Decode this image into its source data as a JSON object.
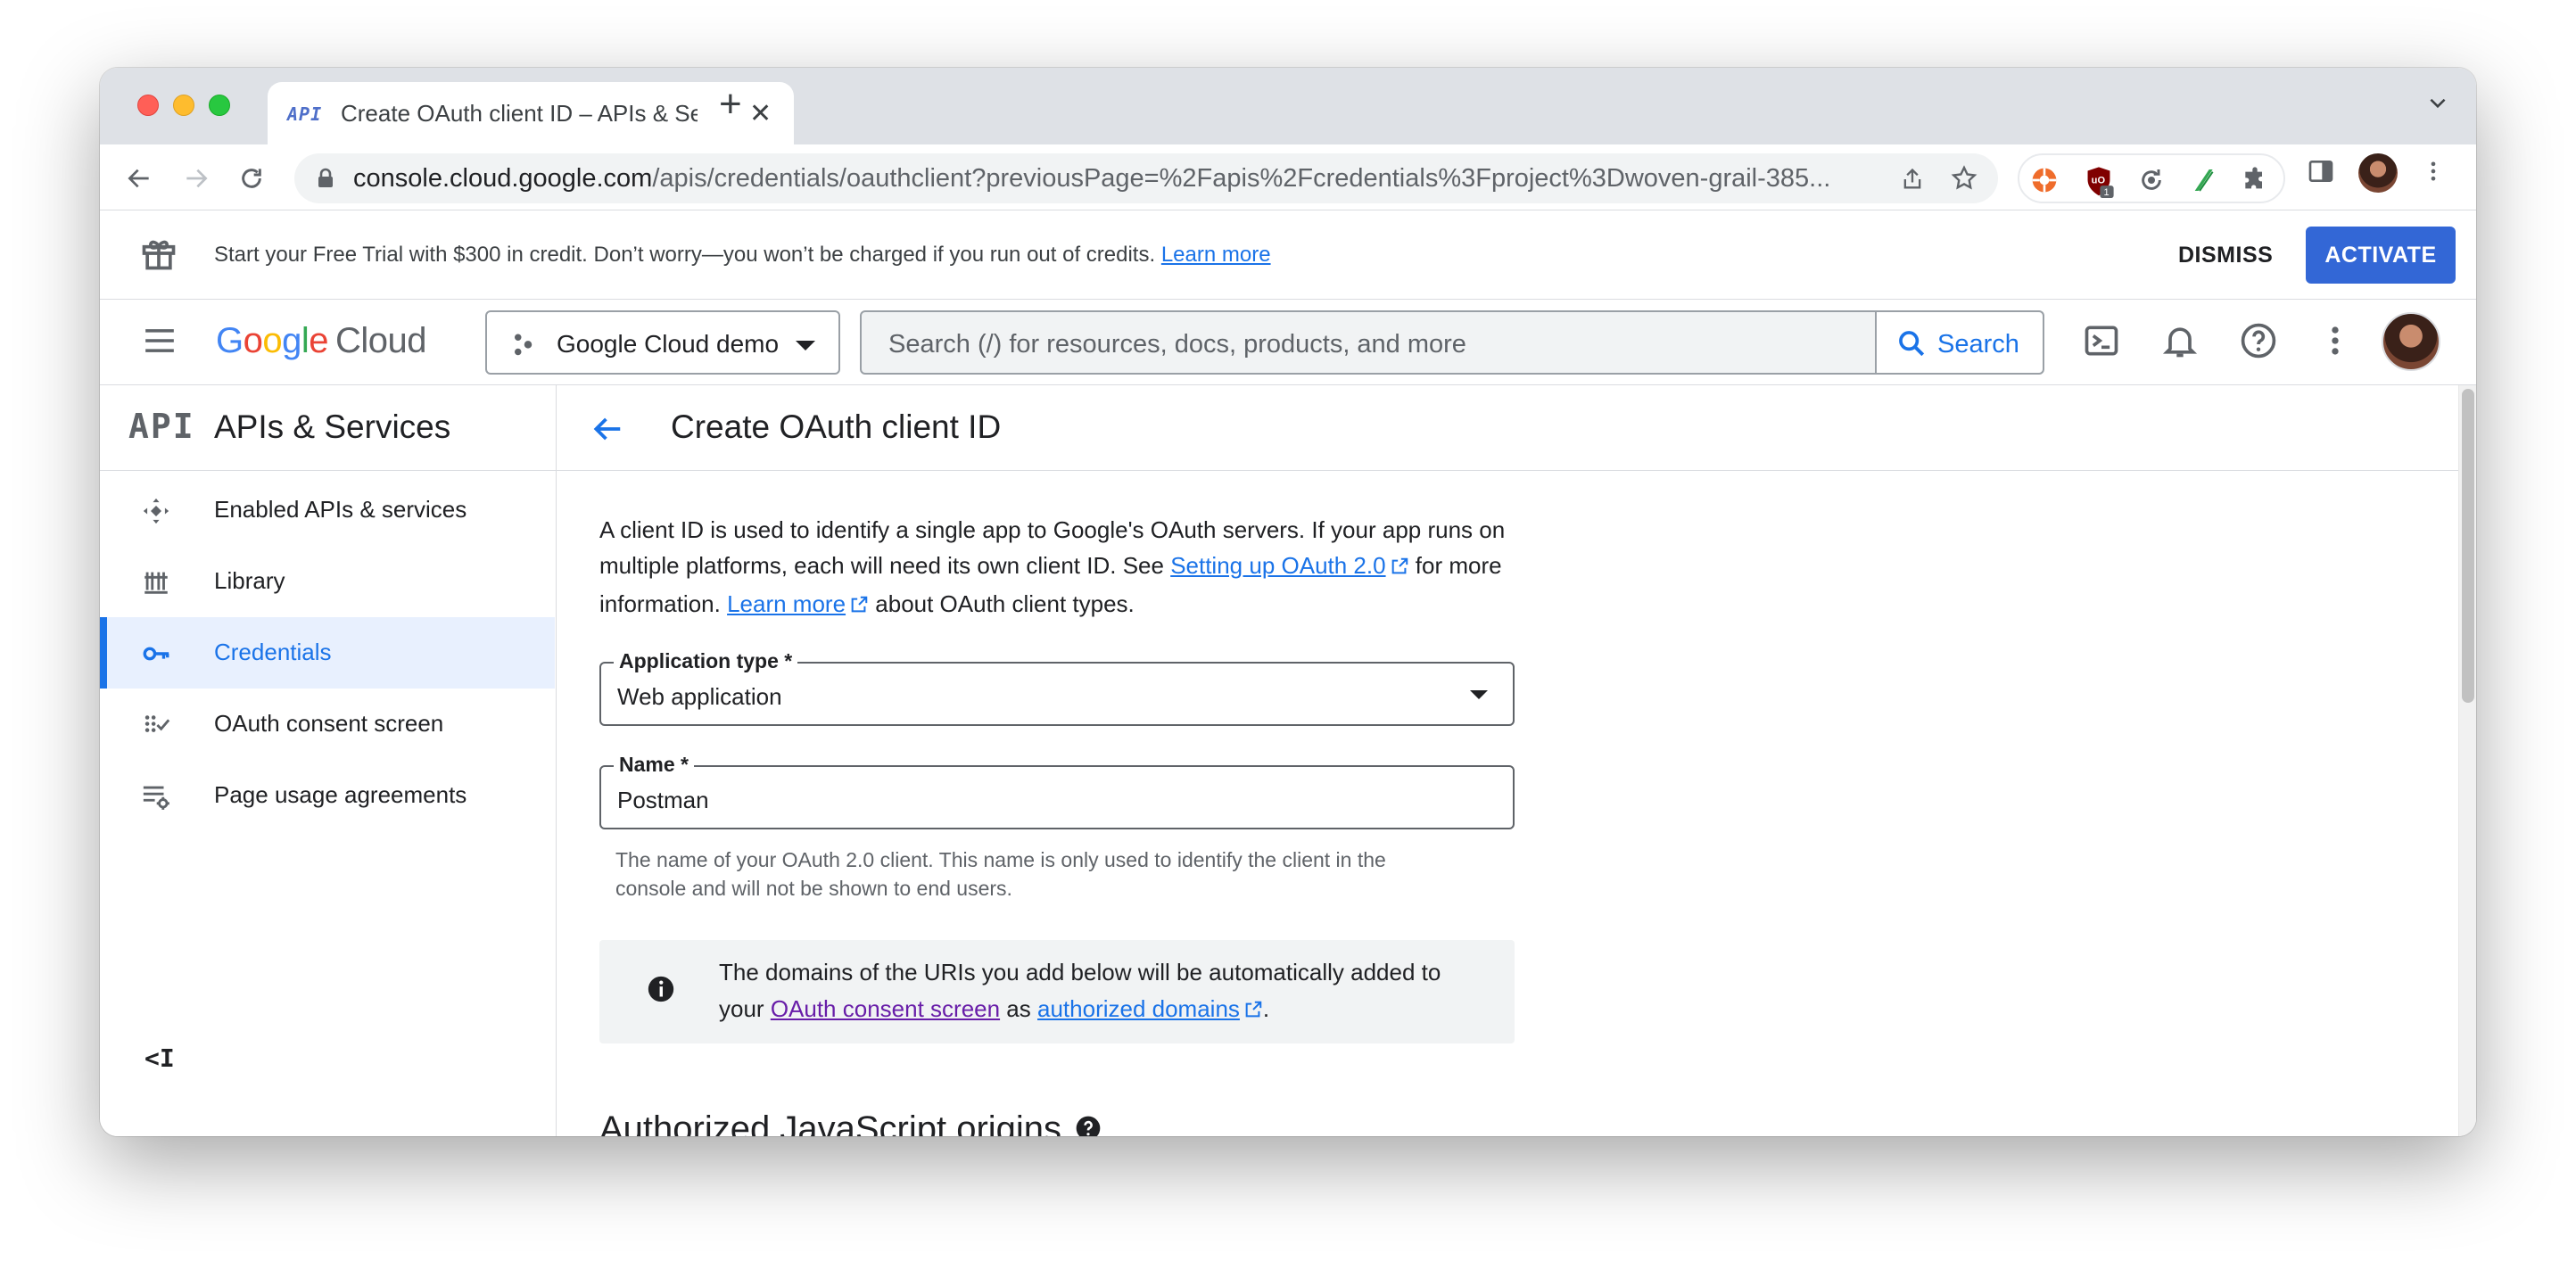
{
  "browser": {
    "tab_title": "Create OAuth client ID – APIs & Services",
    "tab_favicon_text": "API",
    "url_host": "console.cloud.google.com",
    "url_path": "/apis/credentials/oauthclient?previousPage=%2Fapis%2Fcredentials%3Fproject%3Dwoven-grail-385...",
    "extension_badge": "1"
  },
  "banner": {
    "text": "Start your Free Trial with $300 in credit. Don’t worry—you won’t be charged if you run out of credits.",
    "learn_more": "Learn more",
    "dismiss": "DISMISS",
    "activate": "ACTIVATE"
  },
  "header": {
    "logo_google": "Google",
    "logo_cloud": "Cloud",
    "project": "Google Cloud demo",
    "search_placeholder": "Search (/) for resources, docs, products, and more",
    "search_button": "Search"
  },
  "sidebar": {
    "api_badge": "API",
    "title": "APIs & Services",
    "items": [
      {
        "label": "Enabled APIs & services",
        "icon": "services-icon"
      },
      {
        "label": "Library",
        "icon": "library-icon"
      },
      {
        "label": "Credentials",
        "icon": "key-icon",
        "active": true
      },
      {
        "label": "OAuth consent screen",
        "icon": "consent-icon"
      },
      {
        "label": "Page usage agreements",
        "icon": "settings-list-icon"
      }
    ],
    "collapse": "<I"
  },
  "main": {
    "title": "Create OAuth client ID",
    "intro_1": "A client ID is used to identify a single app to Google's OAuth servers. If your app runs on multiple platforms, each will need its own client ID. See ",
    "intro_link_1": "Setting up OAuth 2.0",
    "intro_2": " for more information. ",
    "intro_link_2": "Learn more",
    "intro_3": " about OAuth client types.",
    "app_type_label": "Application type *",
    "app_type_value": "Web application",
    "name_label": "Name *",
    "name_value": "Postman",
    "name_hint": "The name of your OAuth 2.0 client. This name is only used to identify the client in the console and will not be shown to end users.",
    "info_1": "The domains of the URIs you add below will be automatically added to your ",
    "info_link_1": "OAuth consent screen",
    "info_2": " as ",
    "info_link_2": "authorized domains",
    "info_3": ".",
    "section_title": "Authorized JavaScript origins"
  },
  "colors": {
    "accent": "#1a73e8",
    "activate_bg": "#3367d6",
    "active_nav_bg": "#e8f0fe",
    "visited_link": "#681da8"
  }
}
